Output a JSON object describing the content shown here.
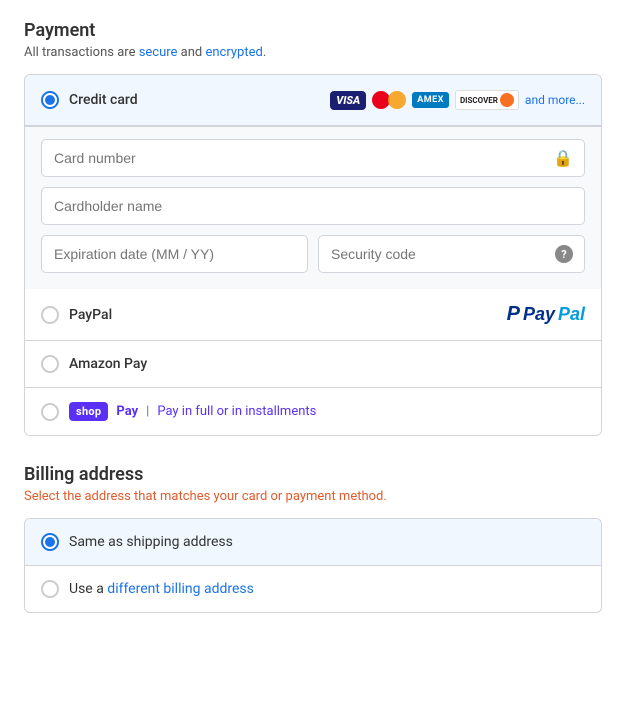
{
  "page": {
    "payment_title": "Payment",
    "secure_text_prefix": "All transactions are secure and encrypted.",
    "secure_link1": "secure",
    "secure_link2": "encrypted"
  },
  "payment_methods": {
    "credit_card": {
      "label": "Credit card",
      "and_more": "and more...",
      "fields": {
        "card_number_placeholder": "Card number",
        "cardholder_placeholder": "Cardholder name",
        "expiration_placeholder": "Expiration date (MM / YY)",
        "security_placeholder": "Security code"
      }
    },
    "paypal": {
      "label": "PayPal"
    },
    "amazon_pay": {
      "label": "Amazon Pay"
    },
    "shop_pay": {
      "label": "shop",
      "pay_label": "Pay",
      "separator": "|",
      "installments_text": "Pay in full or in installments"
    }
  },
  "billing": {
    "title": "Billing address",
    "subtitle": "Select the address that matches your card or payment method.",
    "options": [
      {
        "label": "Same as shipping address",
        "selected": true
      },
      {
        "label": "Use a different billing address",
        "selected": false
      }
    ]
  },
  "icons": {
    "lock": "🔒",
    "question": "?",
    "paypal_p": "P"
  }
}
